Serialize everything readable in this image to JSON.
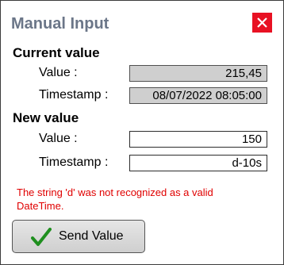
{
  "dialog": {
    "title": "Manual Input",
    "close_icon": "close-icon"
  },
  "current": {
    "heading": "Current value",
    "value_label": "Value :",
    "value": "215,45",
    "timestamp_label": "Timestamp :",
    "timestamp": "08/07/2022 08:05:00"
  },
  "new": {
    "heading": "New value",
    "value_label": "Value :",
    "value": "150",
    "timestamp_label": "Timestamp :",
    "timestamp": "d-10s"
  },
  "error": {
    "message": "The string 'd' was not recognized as a valid DateTime.",
    "color": "#e00000"
  },
  "send_button": {
    "label": "Send Value",
    "icon": "checkmark-icon"
  },
  "colors": {
    "title": "#6b7688",
    "close_bg": "#e81123",
    "readonly_field": "#cfcfcf",
    "check_green": "#1f8f1f"
  }
}
